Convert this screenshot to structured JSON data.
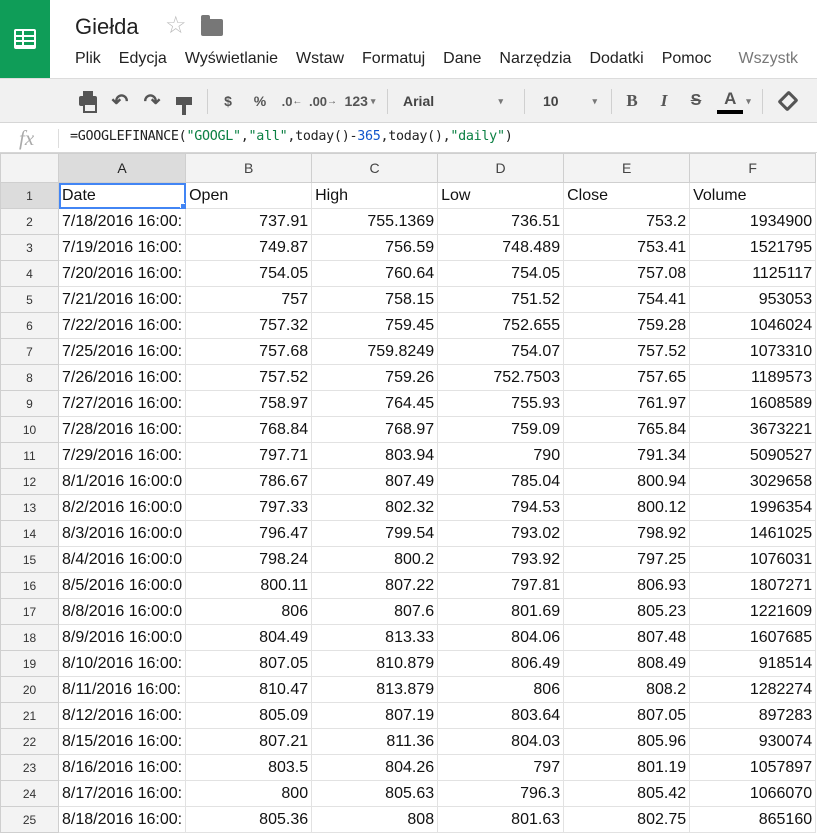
{
  "doc": {
    "title": "Giełda"
  },
  "menu": [
    "Plik",
    "Edycja",
    "Wyświetlanie",
    "Wstaw",
    "Formatuj",
    "Dane",
    "Narzędzia",
    "Dodatki",
    "Pomoc",
    "Wszystk"
  ],
  "toolbar": {
    "currency": "$",
    "percent": "%",
    "decimal_decrease": ".0",
    "decimal_increase": ".00",
    "more_formats": "123",
    "font": "Arial",
    "font_size": "10",
    "bold": "B",
    "italic": "I",
    "strike": "S",
    "text_color_label": "A",
    "text_color": "#000000"
  },
  "formula_bar": {
    "fx_label": "fx",
    "prefix": "=GOOGLEFINANCE(",
    "arg1": "\"GOOGL\"",
    "comma1": ",",
    "arg2": "\"all\"",
    "mid": ",today()-",
    "arg3": "365",
    "mid2": ",today(),",
    "arg4": "\"daily\"",
    "suffix": ")"
  },
  "grid": {
    "columns": [
      "A",
      "B",
      "C",
      "D",
      "E",
      "F"
    ],
    "selected_cell": "A1",
    "rows": [
      [
        "Date",
        "Open",
        "High",
        "Low",
        "Close",
        "Volume"
      ],
      [
        "7/18/2016 16:00:",
        "737.91",
        "755.1369",
        "736.51",
        "753.2",
        "1934900"
      ],
      [
        "7/19/2016 16:00:",
        "749.87",
        "756.59",
        "748.489",
        "753.41",
        "1521795"
      ],
      [
        "7/20/2016 16:00:",
        "754.05",
        "760.64",
        "754.05",
        "757.08",
        "1125117"
      ],
      [
        "7/21/2016 16:00:",
        "757",
        "758.15",
        "751.52",
        "754.41",
        "953053"
      ],
      [
        "7/22/2016 16:00:",
        "757.32",
        "759.45",
        "752.655",
        "759.28",
        "1046024"
      ],
      [
        "7/25/2016 16:00:",
        "757.68",
        "759.8249",
        "754.07",
        "757.52",
        "1073310"
      ],
      [
        "7/26/2016 16:00:",
        "757.52",
        "759.26",
        "752.7503",
        "757.65",
        "1189573"
      ],
      [
        "7/27/2016 16:00:",
        "758.97",
        "764.45",
        "755.93",
        "761.97",
        "1608589"
      ],
      [
        "7/28/2016 16:00:",
        "768.84",
        "768.97",
        "759.09",
        "765.84",
        "3673221"
      ],
      [
        "7/29/2016 16:00:",
        "797.71",
        "803.94",
        "790",
        "791.34",
        "5090527"
      ],
      [
        "8/1/2016 16:00:0",
        "786.67",
        "807.49",
        "785.04",
        "800.94",
        "3029658"
      ],
      [
        "8/2/2016 16:00:0",
        "797.33",
        "802.32",
        "794.53",
        "800.12",
        "1996354"
      ],
      [
        "8/3/2016 16:00:0",
        "796.47",
        "799.54",
        "793.02",
        "798.92",
        "1461025"
      ],
      [
        "8/4/2016 16:00:0",
        "798.24",
        "800.2",
        "793.92",
        "797.25",
        "1076031"
      ],
      [
        "8/5/2016 16:00:0",
        "800.11",
        "807.22",
        "797.81",
        "806.93",
        "1807271"
      ],
      [
        "8/8/2016 16:00:0",
        "806",
        "807.6",
        "801.69",
        "805.23",
        "1221609"
      ],
      [
        "8/9/2016 16:00:0",
        "804.49",
        "813.33",
        "804.06",
        "807.48",
        "1607685"
      ],
      [
        "8/10/2016 16:00:",
        "807.05",
        "810.879",
        "806.49",
        "808.49",
        "918514"
      ],
      [
        "8/11/2016 16:00:",
        "810.47",
        "813.879",
        "806",
        "808.2",
        "1282274"
      ],
      [
        "8/12/2016 16:00:",
        "805.09",
        "807.19",
        "803.64",
        "807.05",
        "897283"
      ],
      [
        "8/15/2016 16:00:",
        "807.21",
        "811.36",
        "804.03",
        "805.96",
        "930074"
      ],
      [
        "8/16/2016 16:00:",
        "803.5",
        "804.26",
        "797",
        "801.19",
        "1057897"
      ],
      [
        "8/17/2016 16:00:",
        "800",
        "805.63",
        "796.3",
        "805.42",
        "1066070"
      ],
      [
        "8/18/2016 16:00:",
        "805.36",
        "808",
        "801.63",
        "802.75",
        "865160"
      ]
    ]
  }
}
